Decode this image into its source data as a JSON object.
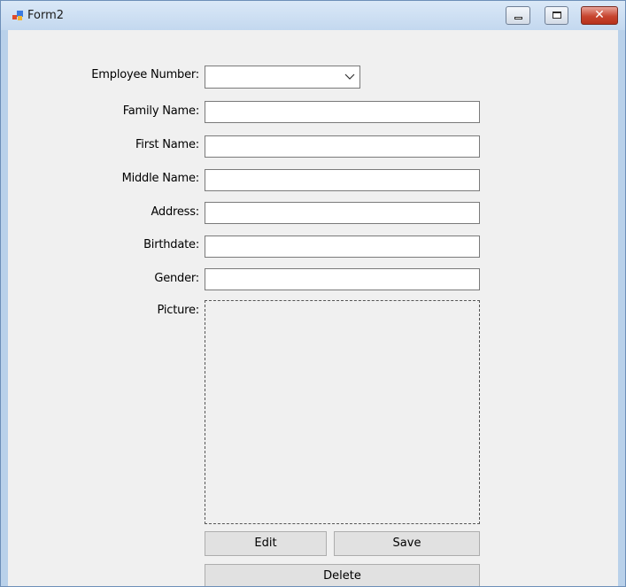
{
  "window": {
    "title": "Form2",
    "close_glyph": "✕"
  },
  "form": {
    "labels": {
      "employee_number": "Employee Number:",
      "family_name": "Family Name:",
      "first_name": "First Name:",
      "middle_name": "Middle Name:",
      "address": "Address:",
      "birthdate": "Birthdate:",
      "gender": "Gender:",
      "picture": "Picture:"
    },
    "values": {
      "employee_number": "",
      "family_name": "",
      "first_name": "",
      "middle_name": "",
      "address": "",
      "birthdate": "",
      "gender": ""
    }
  },
  "buttons": {
    "edit": "Edit",
    "save": "Save",
    "delete": "Delete"
  },
  "icons": {
    "app": "winforms-app-icon",
    "dropdown": "chevron-down-icon"
  },
  "colors": {
    "titlebar": "#c3d8ef",
    "client_bg": "#f0f0f0",
    "close_button": "#c7452f"
  }
}
